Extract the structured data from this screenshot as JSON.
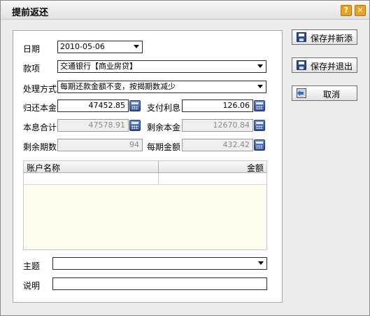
{
  "window": {
    "title": "提前返还"
  },
  "form": {
    "date_label": "日期",
    "date_value": "2010-05-06",
    "item_label": "款项",
    "item_value": "交通银行【商业房贷】",
    "method_label": "处理方式",
    "method_value": "每期还款金额不变，按揭期数减少",
    "return_principal_label": "归还本金",
    "return_principal_value": "47452.85",
    "interest_label": "支付利息",
    "interest_value": "126.06",
    "total_label": "本息合计",
    "total_value": "47578.91",
    "remaining_principal_label": "剩余本金",
    "remaining_principal_value": "12670.84",
    "remaining_periods_label": "剩余期数",
    "remaining_periods_value": "94",
    "per_period_label": "每期金额",
    "per_period_value": "432.42",
    "subject_label": "主题",
    "subject_value": "",
    "note_label": "说明",
    "note_value": ""
  },
  "grid": {
    "columns": [
      "账户名称",
      "金额"
    ],
    "rows": [
      [
        "",
        ""
      ]
    ]
  },
  "buttons": {
    "save_new": "保存并新添",
    "save_exit": "保存并退出",
    "cancel": "取消"
  },
  "icons": {
    "help": "help-icon",
    "close": "close-icon",
    "calculator": "calculator-icon",
    "save": "save-disk-icon",
    "exit": "exit-door-icon"
  }
}
